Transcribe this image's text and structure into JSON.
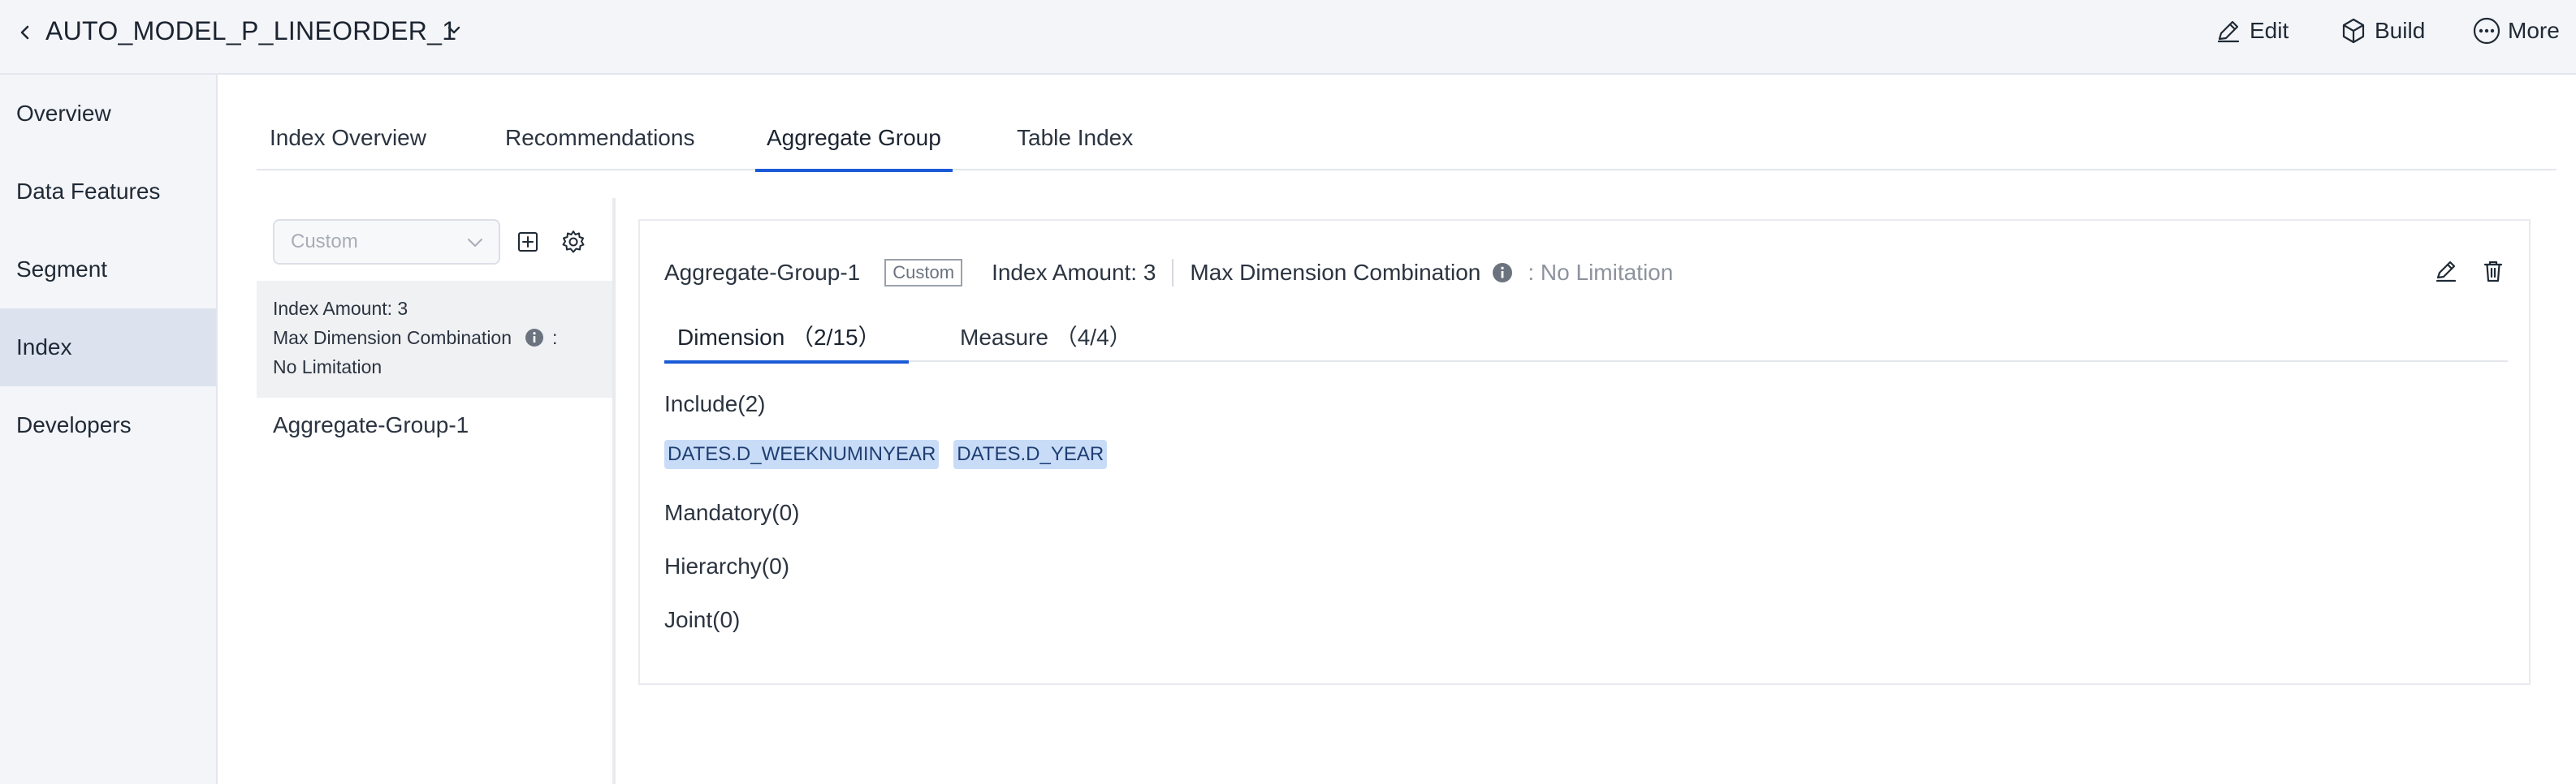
{
  "header": {
    "title": "AUTO_MODEL_P_LINEORDER_1",
    "edit_label": "Edit",
    "build_label": "Build",
    "more_label": "More"
  },
  "sidebar": {
    "items": [
      {
        "label": "Overview"
      },
      {
        "label": "Data Features"
      },
      {
        "label": "Segment"
      },
      {
        "label": "Index"
      },
      {
        "label": "Developers"
      }
    ],
    "active": "Index"
  },
  "tabs": [
    {
      "label": "Index Overview"
    },
    {
      "label": "Recommendations"
    },
    {
      "label": "Aggregate Group"
    },
    {
      "label": "Table Index"
    }
  ],
  "active_tab": "Aggregate Group",
  "left_panel": {
    "select_value": "Custom",
    "summary": {
      "index_amount": "Index Amount: 3",
      "max_dim_label": "Max Dimension Combination",
      "colon": ":",
      "max_dim_value": "No Limitation"
    },
    "groups": [
      "Aggregate-Group-1"
    ]
  },
  "card": {
    "group_name": "Aggregate-Group-1",
    "tag": "Custom",
    "index_amount": "Index Amount: 3",
    "max_dim_label": "Max Dimension Combination",
    "max_dim_value": ": No Limitation",
    "subtabs": [
      {
        "label": "Dimension （2/15）"
      },
      {
        "label": "Measure （4/4）"
      }
    ],
    "include_label": "Include(2)",
    "include_chips": [
      "DATES.D_WEEKNUMINYEAR",
      "DATES.D_YEAR"
    ],
    "mandatory_label": "Mandatory(0)",
    "hierarchy_label": "Hierarchy(0)",
    "joint_label": "Joint(0)"
  },
  "colors": {
    "accent": "#1a5ad7",
    "sidebar_bg": "#f4f5f8",
    "active_nav_bg": "#dce3ef",
    "chip_bg": "#c9dcf7"
  }
}
